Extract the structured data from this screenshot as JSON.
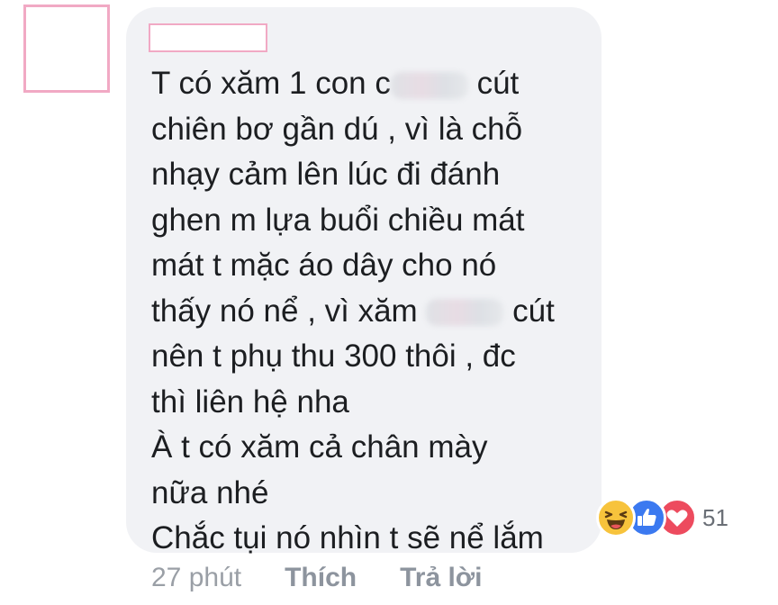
{
  "comment": {
    "lines": [
      {
        "before": "T có xăm 1 con c",
        "after": " cút"
      },
      {
        "text": "chiên bơ gần dú , vì là chỗ"
      },
      {
        "text": "nhạy cảm lên lúc đi đánh"
      },
      {
        "text": "ghen m lựa buổi chiều mát"
      },
      {
        "text": "mát t mặc áo dây cho nó"
      },
      {
        "before": "thấy nó nể , vì xăm ",
        "after": " cút"
      },
      {
        "text": "nên t phụ thu 300 thôi , đc"
      },
      {
        "text": "thì liên hệ nha"
      },
      {
        "text": "À t có xăm cả chân mày"
      },
      {
        "text": "nữa nhé"
      },
      {
        "text": "Chắc tụi nó nhìn t sẽ nể lắm"
      }
    ]
  },
  "reactions": {
    "icons": [
      "haha-icon",
      "like-icon",
      "love-icon"
    ],
    "count": "51",
    "colors": {
      "haha": "#f7c33c",
      "like": "#3b79f0",
      "love": "#ed4b5e"
    }
  },
  "actions": {
    "time": "27 phút",
    "like_label": "Thích",
    "reply_label": "Trả lời"
  },
  "colors": {
    "bubble": "#f1f2f5",
    "text": "#1c1e21",
    "meta": "#8d949e",
    "redaction_border": "#f1a9c4"
  }
}
